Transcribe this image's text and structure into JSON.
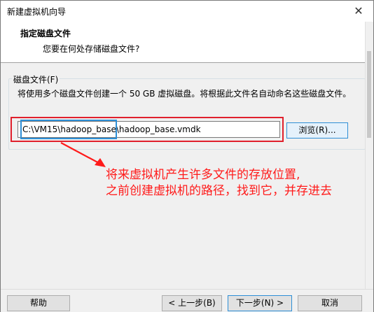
{
  "window": {
    "title": "新建虚拟机向导"
  },
  "header": {
    "title": "指定磁盘文件",
    "subtitle": "您要在何处存储磁盘文件?"
  },
  "disk_group": {
    "label": "磁盘文件(F)",
    "description": "将使用多个磁盘文件创建一个 50 GB 虚拟磁盘。将根据此文件名自动命名这些磁盘文件。",
    "path_value": "C:\\VM15\\hadoop_base\\hadoop_base.vmdk",
    "browse_label": "浏览(R)..."
  },
  "annotation": {
    "line1": "将来虚拟机产生许多文件的存放位置,",
    "line2": "之前创建虚拟机的路径，找到它，并存进去",
    "color": "#ff1a1a"
  },
  "footer": {
    "help": "帮助",
    "back": "< 上一步(B)",
    "next": "下一步(N) >",
    "cancel": "取消"
  }
}
